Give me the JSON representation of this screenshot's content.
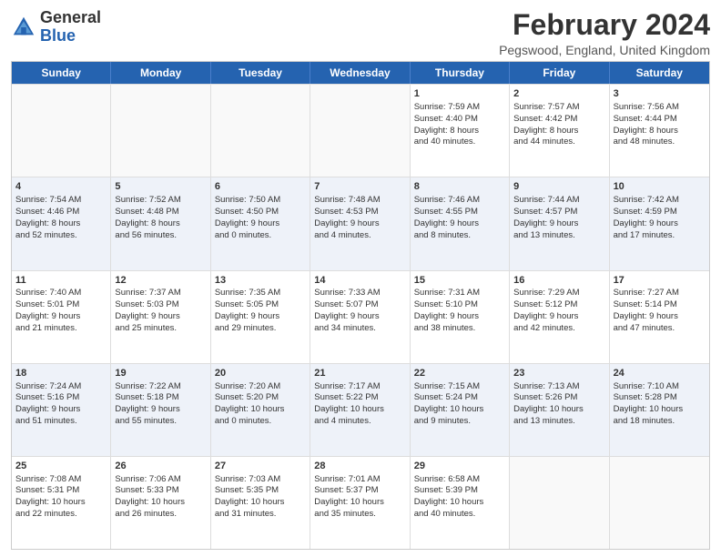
{
  "header": {
    "logo_general": "General",
    "logo_blue": "Blue",
    "month_title": "February 2024",
    "location": "Pegswood, England, United Kingdom"
  },
  "days_of_week": [
    "Sunday",
    "Monday",
    "Tuesday",
    "Wednesday",
    "Thursday",
    "Friday",
    "Saturday"
  ],
  "weeks": [
    [
      {
        "day": "",
        "info": ""
      },
      {
        "day": "",
        "info": ""
      },
      {
        "day": "",
        "info": ""
      },
      {
        "day": "",
        "info": ""
      },
      {
        "day": "1",
        "info": "Sunrise: 7:59 AM\nSunset: 4:40 PM\nDaylight: 8 hours\nand 40 minutes."
      },
      {
        "day": "2",
        "info": "Sunrise: 7:57 AM\nSunset: 4:42 PM\nDaylight: 8 hours\nand 44 minutes."
      },
      {
        "day": "3",
        "info": "Sunrise: 7:56 AM\nSunset: 4:44 PM\nDaylight: 8 hours\nand 48 minutes."
      }
    ],
    [
      {
        "day": "4",
        "info": "Sunrise: 7:54 AM\nSunset: 4:46 PM\nDaylight: 8 hours\nand 52 minutes."
      },
      {
        "day": "5",
        "info": "Sunrise: 7:52 AM\nSunset: 4:48 PM\nDaylight: 8 hours\nand 56 minutes."
      },
      {
        "day": "6",
        "info": "Sunrise: 7:50 AM\nSunset: 4:50 PM\nDaylight: 9 hours\nand 0 minutes."
      },
      {
        "day": "7",
        "info": "Sunrise: 7:48 AM\nSunset: 4:53 PM\nDaylight: 9 hours\nand 4 minutes."
      },
      {
        "day": "8",
        "info": "Sunrise: 7:46 AM\nSunset: 4:55 PM\nDaylight: 9 hours\nand 8 minutes."
      },
      {
        "day": "9",
        "info": "Sunrise: 7:44 AM\nSunset: 4:57 PM\nDaylight: 9 hours\nand 13 minutes."
      },
      {
        "day": "10",
        "info": "Sunrise: 7:42 AM\nSunset: 4:59 PM\nDaylight: 9 hours\nand 17 minutes."
      }
    ],
    [
      {
        "day": "11",
        "info": "Sunrise: 7:40 AM\nSunset: 5:01 PM\nDaylight: 9 hours\nand 21 minutes."
      },
      {
        "day": "12",
        "info": "Sunrise: 7:37 AM\nSunset: 5:03 PM\nDaylight: 9 hours\nand 25 minutes."
      },
      {
        "day": "13",
        "info": "Sunrise: 7:35 AM\nSunset: 5:05 PM\nDaylight: 9 hours\nand 29 minutes."
      },
      {
        "day": "14",
        "info": "Sunrise: 7:33 AM\nSunset: 5:07 PM\nDaylight: 9 hours\nand 34 minutes."
      },
      {
        "day": "15",
        "info": "Sunrise: 7:31 AM\nSunset: 5:10 PM\nDaylight: 9 hours\nand 38 minutes."
      },
      {
        "day": "16",
        "info": "Sunrise: 7:29 AM\nSunset: 5:12 PM\nDaylight: 9 hours\nand 42 minutes."
      },
      {
        "day": "17",
        "info": "Sunrise: 7:27 AM\nSunset: 5:14 PM\nDaylight: 9 hours\nand 47 minutes."
      }
    ],
    [
      {
        "day": "18",
        "info": "Sunrise: 7:24 AM\nSunset: 5:16 PM\nDaylight: 9 hours\nand 51 minutes."
      },
      {
        "day": "19",
        "info": "Sunrise: 7:22 AM\nSunset: 5:18 PM\nDaylight: 9 hours\nand 55 minutes."
      },
      {
        "day": "20",
        "info": "Sunrise: 7:20 AM\nSunset: 5:20 PM\nDaylight: 10 hours\nand 0 minutes."
      },
      {
        "day": "21",
        "info": "Sunrise: 7:17 AM\nSunset: 5:22 PM\nDaylight: 10 hours\nand 4 minutes."
      },
      {
        "day": "22",
        "info": "Sunrise: 7:15 AM\nSunset: 5:24 PM\nDaylight: 10 hours\nand 9 minutes."
      },
      {
        "day": "23",
        "info": "Sunrise: 7:13 AM\nSunset: 5:26 PM\nDaylight: 10 hours\nand 13 minutes."
      },
      {
        "day": "24",
        "info": "Sunrise: 7:10 AM\nSunset: 5:28 PM\nDaylight: 10 hours\nand 18 minutes."
      }
    ],
    [
      {
        "day": "25",
        "info": "Sunrise: 7:08 AM\nSunset: 5:31 PM\nDaylight: 10 hours\nand 22 minutes."
      },
      {
        "day": "26",
        "info": "Sunrise: 7:06 AM\nSunset: 5:33 PM\nDaylight: 10 hours\nand 26 minutes."
      },
      {
        "day": "27",
        "info": "Sunrise: 7:03 AM\nSunset: 5:35 PM\nDaylight: 10 hours\nand 31 minutes."
      },
      {
        "day": "28",
        "info": "Sunrise: 7:01 AM\nSunset: 5:37 PM\nDaylight: 10 hours\nand 35 minutes."
      },
      {
        "day": "29",
        "info": "Sunrise: 6:58 AM\nSunset: 5:39 PM\nDaylight: 10 hours\nand 40 minutes."
      },
      {
        "day": "",
        "info": ""
      },
      {
        "day": "",
        "info": ""
      }
    ]
  ]
}
